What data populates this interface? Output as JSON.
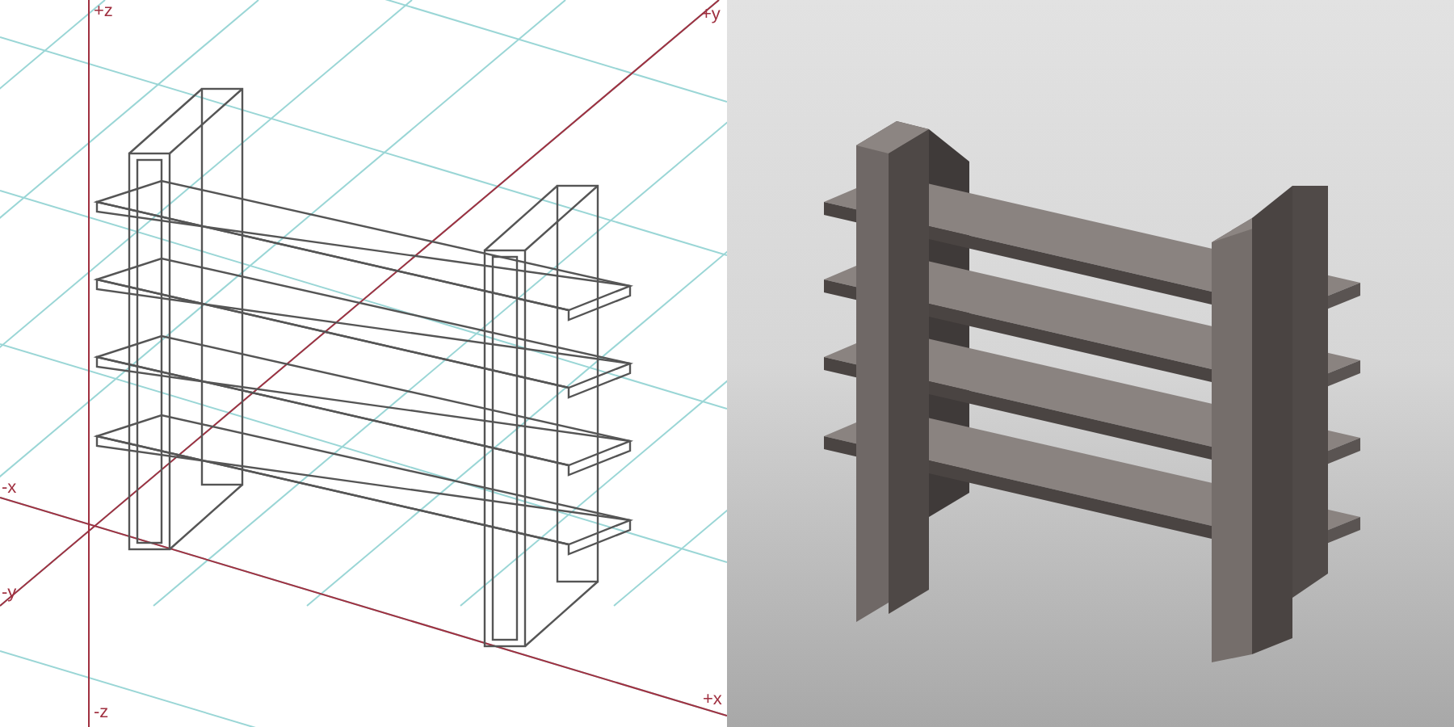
{
  "wireframe_view": {
    "axis_labels": [
      {
        "text": "+z",
        "kind": "top-left"
      },
      {
        "text": "+y",
        "kind": "top-right"
      },
      {
        "text": "-x",
        "kind": "left-upper"
      },
      {
        "text": "-y",
        "kind": "left-lower"
      },
      {
        "text": "-z",
        "kind": "bottom-left"
      },
      {
        "text": "+x",
        "kind": "bottom-right"
      }
    ]
  }
}
